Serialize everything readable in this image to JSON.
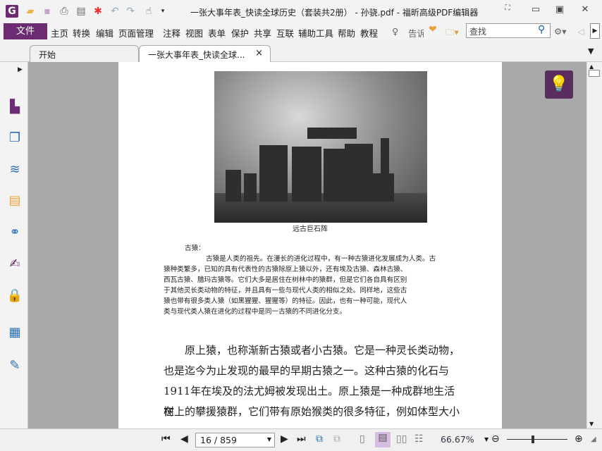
{
  "window": {
    "title": "一张大事年表_快读全球历史（套装共2册） - 孙骁.pdf - 福昕高级PDF编辑器"
  },
  "menu": {
    "file": "文件",
    "items": [
      "主页",
      "转换",
      "编辑",
      "页面管理",
      "注释",
      "视图",
      "表单",
      "保护",
      "共享",
      "互联",
      "辅助工具",
      "帮助",
      "教程"
    ],
    "tell": "告诉",
    "search_placeholder": "查找"
  },
  "tabs": [
    {
      "label": "开始"
    },
    {
      "label": "一张大事年表_快读全球...",
      "close": "×"
    }
  ],
  "document": {
    "caption": "远古巨石阵",
    "heading": "古猿：",
    "small_lines": [
      "古猿是人类的祖先。在漫长的进化过程中，有一种古猿进化发展成为人类。古",
      "猿种类繁多，已知的具有代表性的古猿除原上猿以外，还有埃及古猿、森林古猿、",
      "西瓦古猿、腊玛古猿等。它们大多是居住在树林中的猿群，但是它们各自具有区别",
      "于其他灵长类动物的特征，并且具有一些与现代人类的相似之处。同样地，这些古",
      "猿也带有很多类人猿（如黑猩猩、猩猩等）的特征。因此，也有一种可能，现代人",
      "类与现代类人猿在进化的过程中是同一古猿的不同进化分支。"
    ],
    "body_lines": [
      "原上猿，也称渐新古猿或者小古猿。它是一种灵长类动物，",
      "也是迄今为止发现的最早的早期古猿之一。这种古猿的化石与",
      "1911年在埃及的法尤姆被发现出土。原上猿是一种成群地生活在",
      "树上的攀援猿群，它们带有原始猴类的很多特征，例如体型大小"
    ]
  },
  "status": {
    "page": "16 / 859",
    "zoom": "66.67%"
  },
  "colors": {
    "accent": "#6b2c71",
    "bulb_bg": "#5a2d5f"
  }
}
